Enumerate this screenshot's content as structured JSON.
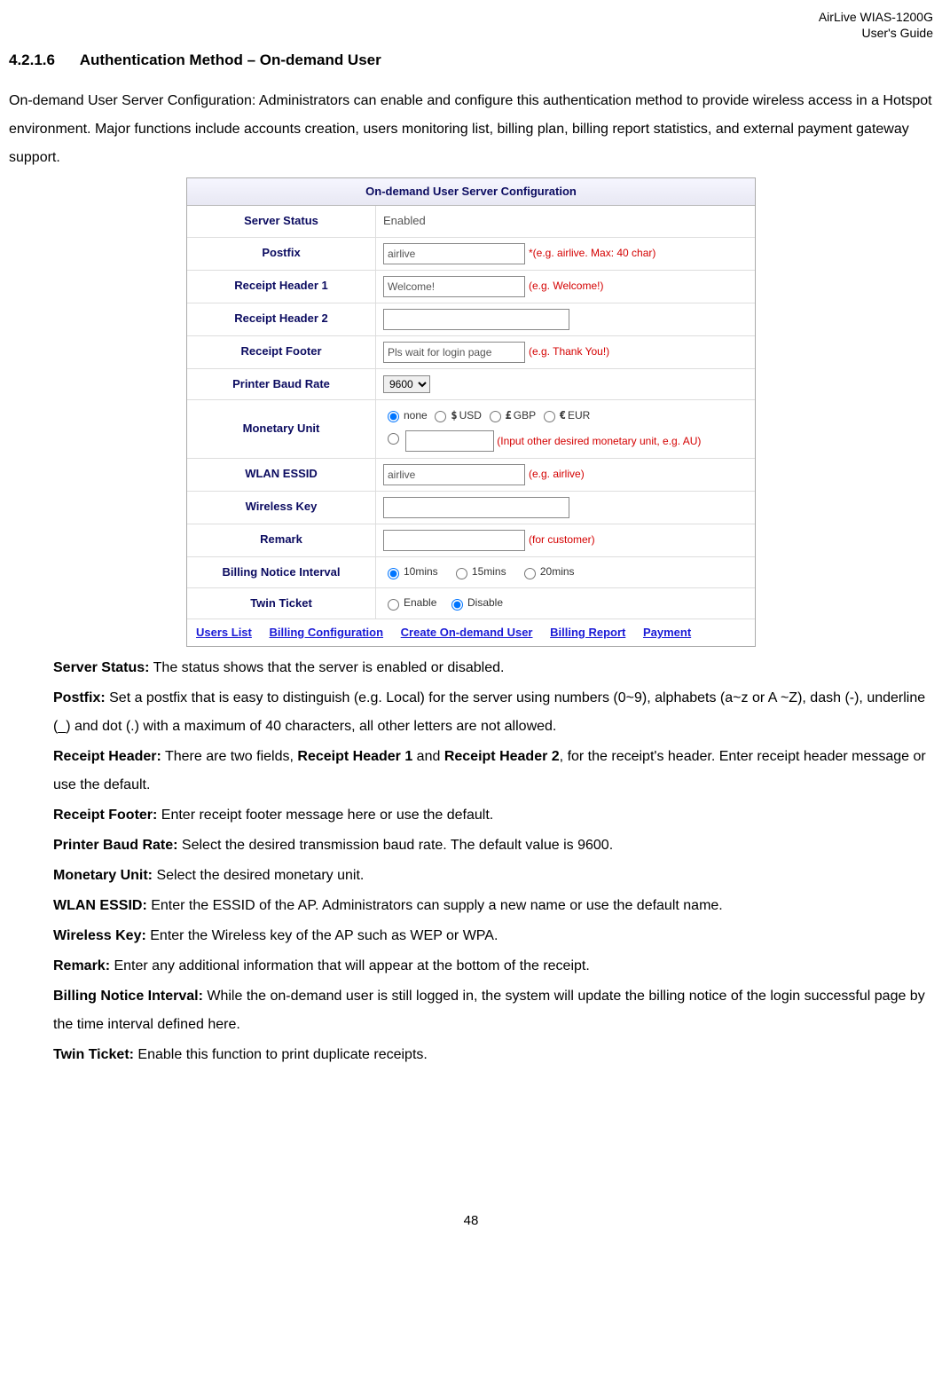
{
  "header": {
    "line1": "AirLive WIAS-1200G",
    "line2": "User's Guide"
  },
  "section": {
    "number": "4.2.1.6",
    "title": "Authentication Method – On-demand User"
  },
  "intro": "On-demand User Server Configuration: Administrators can enable and configure this authentication method to provide wireless access in a Hotspot environment. Major functions include accounts creation, users monitoring list, billing plan, billing report statistics, and external payment gateway support.",
  "config": {
    "title": "On-demand User Server Configuration",
    "server_status": {
      "label": "Server Status",
      "value": "Enabled"
    },
    "postfix": {
      "label": "Postfix",
      "value": "airlive",
      "hint": "*(e.g. airlive. Max: 40 char)"
    },
    "header1": {
      "label": "Receipt Header 1",
      "value": "Welcome!",
      "hint": "(e.g. Welcome!)"
    },
    "header2": {
      "label": "Receipt Header 2",
      "value": ""
    },
    "footer": {
      "label": "Receipt Footer",
      "value": "Pls wait for login page",
      "hint": "(e.g. Thank You!)"
    },
    "baud": {
      "label": "Printer Baud Rate",
      "value": "9600"
    },
    "monetary": {
      "label": "Monetary Unit",
      "none": "none",
      "usd": "USD",
      "gbp": "GBP",
      "eur": "EUR",
      "other_hint": "(Input other desired monetary unit, e.g. AU)"
    },
    "essid": {
      "label": "WLAN ESSID",
      "value": "airlive",
      "hint": "(e.g. airlive)"
    },
    "wkey": {
      "label": "Wireless Key",
      "value": ""
    },
    "remark": {
      "label": "Remark",
      "value": "",
      "hint": "(for customer)"
    },
    "billnotice": {
      "label": "Billing Notice Interval",
      "o1": "10mins",
      "o2": "15mins",
      "o3": "20mins"
    },
    "twin": {
      "label": "Twin Ticket",
      "enable": "Enable",
      "disable": "Disable"
    },
    "links": {
      "l1": "Users List",
      "l2": "Billing Configuration",
      "l3": "Create On-demand User",
      "l4": "Billing Report",
      "l5": "Payment"
    }
  },
  "descriptions": {
    "server_status": {
      "label": "Server Status:",
      "text": " The status shows that the server is enabled or disabled."
    },
    "postfix": {
      "label": "Postfix:",
      "text": " Set a postfix that is easy to distinguish (e.g. Local) for the server using numbers (0~9), alphabets (a~z or A ~Z), dash (-), underline (_) and dot (.) with a maximum of 40 characters, all other letters are not allowed."
    },
    "receipt_header": {
      "label": "Receipt Header:",
      "text_pre": " There are two fields, ",
      "b1": "Receipt Header 1",
      "mid": " and ",
      "b2": "Receipt Header 2",
      "text_post": ", for the receipt's header. Enter receipt header message or use the default."
    },
    "receipt_footer": {
      "label": "Receipt Footer:",
      "text": " Enter receipt footer message here or use the default."
    },
    "baud": {
      "label": "Printer Baud Rate:",
      "text": " Select the desired transmission baud rate. The default value is 9600."
    },
    "monetary": {
      "label": "Monetary Unit:",
      "text": " Select the desired monetary unit."
    },
    "essid": {
      "label": "WLAN ESSID:",
      "text": " Enter the ESSID of the AP. Administrators can supply a new name or use the default name."
    },
    "wkey": {
      "label": "Wireless Key:",
      "text": " Enter the Wireless key of the AP such as WEP or WPA."
    },
    "remark": {
      "label": "Remark:",
      "text": " Enter any additional information that will appear at the bottom of the receipt."
    },
    "billnotice": {
      "label": "Billing Notice Interval:",
      "text": " While the on-demand user is still logged in, the system will update the billing notice of the login successful page by the time interval defined here."
    },
    "twin": {
      "label": "Twin Ticket:",
      "text": " Enable this function to print duplicate receipts."
    }
  },
  "page_number": "48"
}
